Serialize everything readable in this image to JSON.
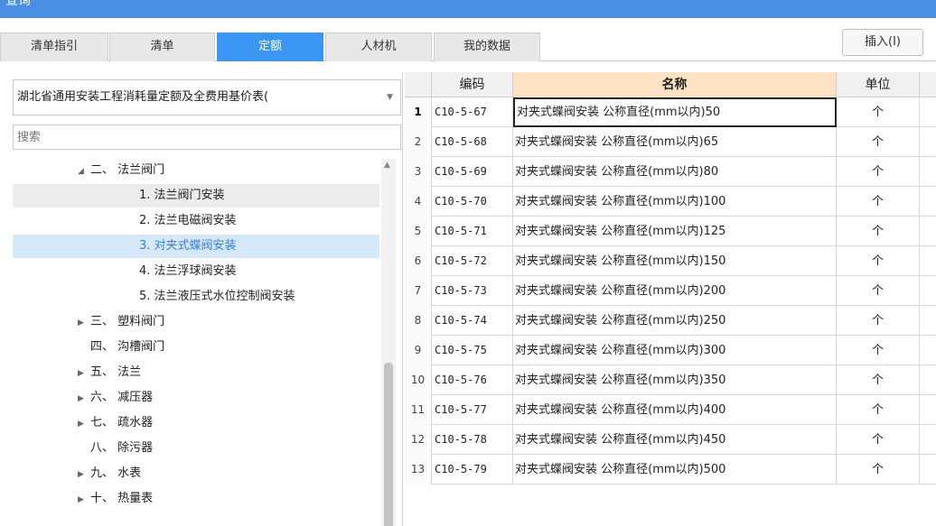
{
  "window": {
    "title": "查询"
  },
  "tabs": [
    {
      "label": "清单指引"
    },
    {
      "label": "清单"
    },
    {
      "label": "定额"
    },
    {
      "label": "人材机"
    },
    {
      "label": "我的数据"
    }
  ],
  "active_tab": "定额",
  "toolbar": {
    "insert_label": "插入(I)"
  },
  "library_select": {
    "value": "湖北省通用安装工程消耗量定额及全费用基价表("
  },
  "search": {
    "placeholder": "搜索"
  },
  "tree": [
    {
      "label": "二、 法兰阀门",
      "arrow": "◢",
      "indent": 72
    },
    {
      "label": "1. 法兰阀门安装",
      "arrow": "",
      "indent": 126
    },
    {
      "label": "2. 法兰电磁阀安装",
      "arrow": "",
      "indent": 126
    },
    {
      "label": "3. 对夹式蝶阀安装",
      "arrow": "",
      "indent": 126
    },
    {
      "label": "4. 法兰浮球阀安装",
      "arrow": "",
      "indent": 126
    },
    {
      "label": "5. 法兰液压式水位控制阀安装",
      "arrow": "",
      "indent": 126
    },
    {
      "label": "三、 塑料阀门",
      "arrow": "▶",
      "indent": 72
    },
    {
      "label": "四、 沟槽阀门",
      "arrow": "",
      "indent": 72
    },
    {
      "label": "五、 法兰",
      "arrow": "▶",
      "indent": 72
    },
    {
      "label": "六、 减压器",
      "arrow": "▶",
      "indent": 72
    },
    {
      "label": "七、 疏水器",
      "arrow": "▶",
      "indent": 72
    },
    {
      "label": "八、 除污器",
      "arrow": "",
      "indent": 72
    },
    {
      "label": "九、 水表",
      "arrow": "▶",
      "indent": 72
    },
    {
      "label": "十、 热量表",
      "arrow": "▶",
      "indent": 72
    }
  ],
  "tree_selected": "3. 对夹式蝶阀安装",
  "tree_hover": "1. 法兰阀门安装",
  "table": {
    "columns": [
      "编码",
      "名称",
      "单位"
    ],
    "rows": [
      {
        "idx": "1",
        "code": "C10-5-67",
        "name": "对夹式蝶阀安装 公称直径(mm以内)50",
        "unit": "个"
      },
      {
        "idx": "2",
        "code": "C10-5-68",
        "name": "对夹式蝶阀安装 公称直径(mm以内)65",
        "unit": "个"
      },
      {
        "idx": "3",
        "code": "C10-5-69",
        "name": "对夹式蝶阀安装 公称直径(mm以内)80",
        "unit": "个"
      },
      {
        "idx": "4",
        "code": "C10-5-70",
        "name": "对夹式蝶阀安装 公称直径(mm以内)100",
        "unit": "个"
      },
      {
        "idx": "5",
        "code": "C10-5-71",
        "name": "对夹式蝶阀安装 公称直径(mm以内)125",
        "unit": "个"
      },
      {
        "idx": "6",
        "code": "C10-5-72",
        "name": "对夹式蝶阀安装 公称直径(mm以内)150",
        "unit": "个"
      },
      {
        "idx": "7",
        "code": "C10-5-73",
        "name": "对夹式蝶阀安装 公称直径(mm以内)200",
        "unit": "个"
      },
      {
        "idx": "8",
        "code": "C10-5-74",
        "name": "对夹式蝶阀安装 公称直径(mm以内)250",
        "unit": "个"
      },
      {
        "idx": "9",
        "code": "C10-5-75",
        "name": "对夹式蝶阀安装 公称直径(mm以内)300",
        "unit": "个"
      },
      {
        "idx": "10",
        "code": "C10-5-76",
        "name": "对夹式蝶阀安装 公称直径(mm以内)350",
        "unit": "个"
      },
      {
        "idx": "11",
        "code": "C10-5-77",
        "name": "对夹式蝶阀安装 公称直径(mm以内)400",
        "unit": "个"
      },
      {
        "idx": "12",
        "code": "C10-5-78",
        "name": "对夹式蝶阀安装 公称直径(mm以内)450",
        "unit": "个"
      },
      {
        "idx": "13",
        "code": "C10-5-79",
        "name": "对夹式蝶阀安装 公称直径(mm以内)500",
        "unit": "个"
      }
    ]
  },
  "colors": {
    "accent": "#3b95f2",
    "title_bar": "#4a8fe3",
    "selected_row": "#d5e9fb",
    "name_header": "#fde3c4"
  }
}
